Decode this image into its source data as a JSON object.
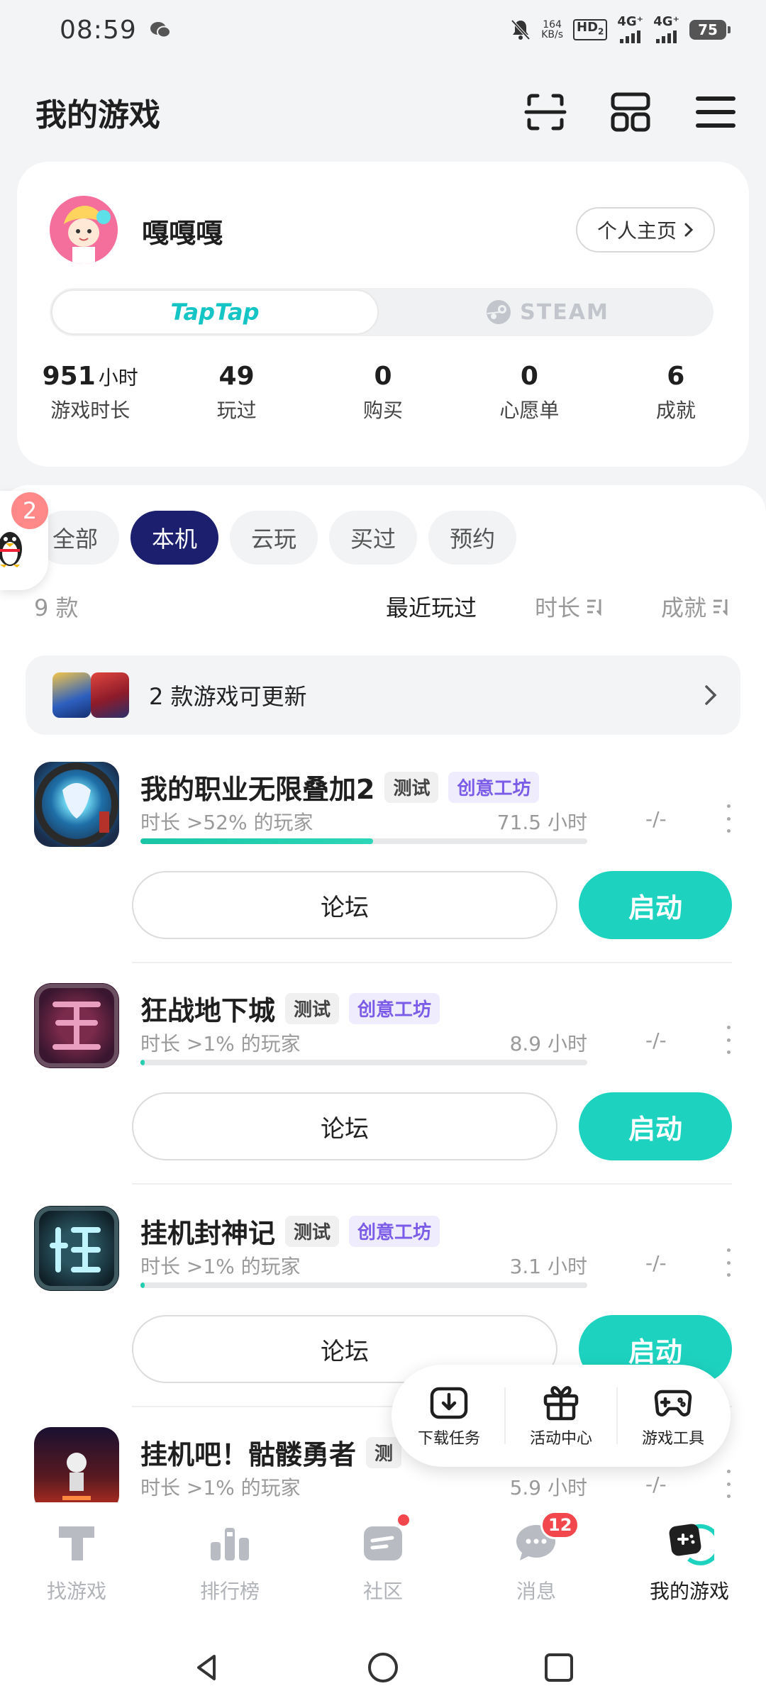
{
  "status_bar": {
    "time": "08:59",
    "net_speed_value": "164",
    "net_speed_unit": "KB/s",
    "hd_tag": "HD",
    "hd_sub": "2",
    "signal_1": "4G⁺",
    "signal_2": "4G⁺",
    "battery": "75"
  },
  "header": {
    "title": "我的游戏",
    "icons": [
      "scan-icon",
      "apps-grid-icon",
      "menu-icon"
    ]
  },
  "profile": {
    "username": "嘎嘎嘎",
    "homepage_label": "个人主页",
    "platform_taptap": "TapTap",
    "platform_steam": "STEAM",
    "stats": [
      {
        "value": "951",
        "unit": "小时",
        "label": "游戏时长"
      },
      {
        "value": "49",
        "unit": "",
        "label": "玩过"
      },
      {
        "value": "0",
        "unit": "",
        "label": "购买"
      },
      {
        "value": "0",
        "unit": "",
        "label": "心愿单"
      },
      {
        "value": "6",
        "unit": "",
        "label": "成就"
      }
    ]
  },
  "float_qq": {
    "badge": "2"
  },
  "filters": {
    "chips": [
      "全部",
      "本机",
      "云玩",
      "买过",
      "预约"
    ],
    "active": "本机"
  },
  "sort_bar": {
    "count": "9 款",
    "sort_recent": "最近玩过",
    "sort_duration": "时长",
    "sort_achievement": "成就"
  },
  "update_banner": {
    "text": "2 款游戏可更新"
  },
  "games": [
    {
      "name": "我的职业无限叠加2",
      "tag_test": "测试",
      "tag_workshop": "创意工坊",
      "rank": "时长 >52% 的玩家",
      "hours": "71.5 小时",
      "achievement": "-/-",
      "progress": 0.52,
      "forum": "论坛",
      "launch": "启动"
    },
    {
      "name": "狂战地下城",
      "tag_test": "测试",
      "tag_workshop": "创意工坊",
      "rank": "时长 >1% 的玩家",
      "hours": "8.9 小时",
      "achievement": "-/-",
      "progress": 0.01,
      "forum": "论坛",
      "launch": "启动"
    },
    {
      "name": "挂机封神记",
      "tag_test": "测试",
      "tag_workshop": "创意工坊",
      "rank": "时长 >1% 的玩家",
      "hours": "3.1 小时",
      "achievement": "-/-",
      "progress": 0.01,
      "forum": "论坛",
      "launch": "启动"
    },
    {
      "name": "挂机吧！骷髅勇者",
      "tag_test": "测",
      "tag_workshop": "",
      "rank": "时长 >1% 的玩家",
      "hours": "5.9 小时",
      "achievement": "-/-",
      "progress": 0.01,
      "forum": "",
      "launch": ""
    }
  ],
  "tools": {
    "download": "下载任务",
    "activity": "活动中心",
    "game_tools": "游戏工具"
  },
  "bottom_nav": {
    "items": [
      "找游戏",
      "排行榜",
      "社区",
      "消息",
      "我的游戏"
    ],
    "active": "我的游戏",
    "message_badge": "12"
  },
  "colors": {
    "accent": "#1dd3c0",
    "active_chip": "#1b1f6e",
    "workshop_text": "#7b5ce8",
    "badge_red": "#f2474d",
    "taptap": "#15c5c5"
  }
}
